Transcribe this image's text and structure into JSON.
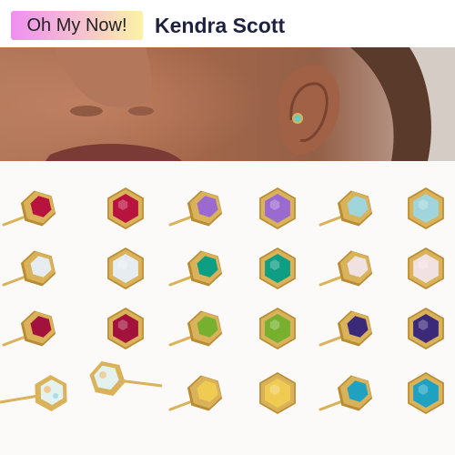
{
  "header": {
    "badge_label": "Oh My Now!",
    "brand_title": "Kendra Scott"
  },
  "colors": {
    "gold": "#d9b25a",
    "gold_dark": "#b98c33",
    "background": "#fbfaf8"
  },
  "products": {
    "rows": [
      [
        {
          "stone": "ruby",
          "color": "#b8123f",
          "view": "side"
        },
        {
          "stone": "ruby",
          "color": "#b8123f",
          "view": "front"
        },
        {
          "stone": "amethyst",
          "color": "#9a6ad0",
          "view": "side"
        },
        {
          "stone": "amethyst",
          "color": "#9a6ad0",
          "view": "front"
        },
        {
          "stone": "aquamarine",
          "color": "#9fd5db",
          "view": "side"
        },
        {
          "stone": "aquamarine",
          "color": "#9fd5db",
          "view": "front"
        }
      ],
      [
        {
          "stone": "moonstone",
          "color": "#e6ecef",
          "view": "side"
        },
        {
          "stone": "moonstone",
          "color": "#e6ecef",
          "view": "front"
        },
        {
          "stone": "green onyx",
          "color": "#0d9e84",
          "view": "side"
        },
        {
          "stone": "green onyx",
          "color": "#0d9e84",
          "view": "front"
        },
        {
          "stone": "rose quartz",
          "color": "#f1e1e0",
          "view": "side"
        },
        {
          "stone": "rose quartz",
          "color": "#f1e1e0",
          "view": "front"
        }
      ],
      [
        {
          "stone": "garnet",
          "color": "#a3123c",
          "view": "side"
        },
        {
          "stone": "garnet",
          "color": "#a3123c",
          "view": "front"
        },
        {
          "stone": "peridot",
          "color": "#76b02e",
          "view": "side"
        },
        {
          "stone": "peridot",
          "color": "#76b02e",
          "view": "front"
        },
        {
          "stone": "iolite",
          "color": "#3b2a7a",
          "view": "side"
        },
        {
          "stone": "iolite",
          "color": "#3b2a7a",
          "view": "front"
        }
      ],
      [
        {
          "stone": "opal",
          "color": "#e3f2ef",
          "view": "pair"
        },
        {
          "stone": "citrine",
          "color": "#f0cb52",
          "view": "side"
        },
        {
          "stone": "citrine",
          "color": "#f0cb52",
          "view": "front"
        },
        {
          "stone": "turquoise",
          "color": "#1fa2c2",
          "view": "side"
        },
        {
          "stone": "turquoise",
          "color": "#1fa2c2",
          "view": "front"
        }
      ]
    ]
  }
}
